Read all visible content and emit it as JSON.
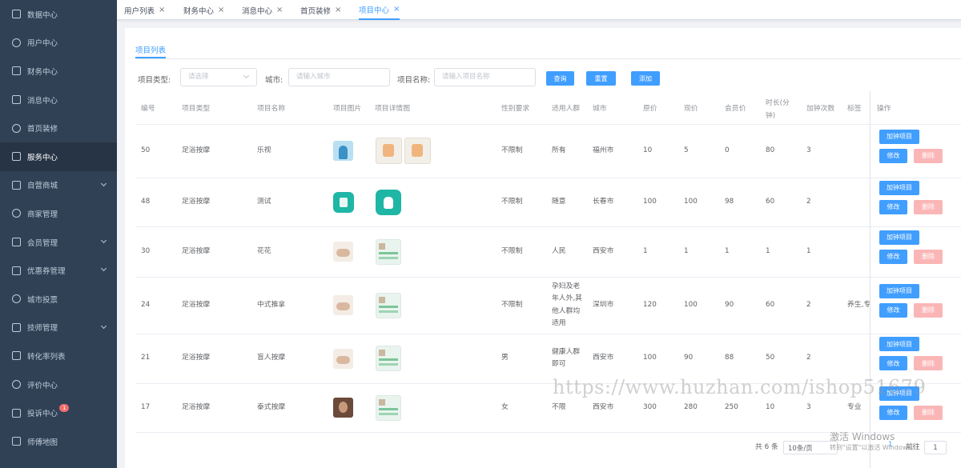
{
  "sidebar": {
    "items": [
      {
        "label": "数据中心",
        "icon": "chart-icon",
        "chevron": false
      },
      {
        "label": "用户中心",
        "icon": "user-icon",
        "chevron": false
      },
      {
        "label": "财务中心",
        "icon": "wallet-icon",
        "chevron": false
      },
      {
        "label": "消息中心",
        "icon": "message-icon",
        "chevron": false
      },
      {
        "label": "首页装修",
        "icon": "cube-icon",
        "chevron": false
      },
      {
        "label": "服务中心",
        "icon": "clipboard-icon",
        "chevron": false,
        "active": true
      },
      {
        "label": "自营商城",
        "icon": "home-icon",
        "chevron": true
      },
      {
        "label": "商家管理",
        "icon": "user-icon",
        "chevron": false
      },
      {
        "label": "会员管理",
        "icon": "member-icon",
        "chevron": true
      },
      {
        "label": "优惠券管理",
        "icon": "coupon-icon",
        "chevron": true
      },
      {
        "label": "城市投票",
        "icon": "vote-icon",
        "chevron": false
      },
      {
        "label": "技师管理",
        "icon": "technician-icon",
        "chevron": true
      },
      {
        "label": "转化率列表",
        "icon": "refresh-icon",
        "chevron": false
      },
      {
        "label": "评价中心",
        "icon": "comment-icon",
        "chevron": false
      },
      {
        "label": "投诉中心",
        "icon": "complaint-icon",
        "chevron": false,
        "badge": "1"
      },
      {
        "label": "师傅地图",
        "icon": "location-icon",
        "chevron": false
      }
    ]
  },
  "tabs": [
    {
      "label": "用户列表",
      "close": "×"
    },
    {
      "label": "财务中心",
      "close": "×"
    },
    {
      "label": "消息中心",
      "close": "×"
    },
    {
      "label": "首页装修",
      "close": "×"
    },
    {
      "label": "项目中心",
      "close": "×",
      "active": true
    }
  ],
  "subtab": {
    "label": "项目列表"
  },
  "filters": {
    "type_label": "项目类型:",
    "type_placeholder": "请选择",
    "city_label": "城市:",
    "city_placeholder": "请输入城市",
    "name_label": "项目名称:",
    "name_placeholder": "请输入项目名称",
    "search_btn": "查询",
    "reset_btn": "重置",
    "add_btn": "添加"
  },
  "table": {
    "headers": {
      "id": "编号",
      "type": "项目类型",
      "name": "项目名称",
      "image": "项目图片",
      "detail": "项目详情图",
      "gender": "性别要求",
      "crowd": "适用人群",
      "city": "城市",
      "orig_price": "原价",
      "price": "现价",
      "member_price": "会员价",
      "duration_1": "时长(分",
      "duration_2": "钟)",
      "extra": "加钟次数",
      "tags": "标签",
      "ops": "操作"
    },
    "rows": [
      {
        "id": "50",
        "type": "足浴按摩",
        "name": "乐视",
        "gender": "不限制",
        "crowd": [
          "所有"
        ],
        "city": "福州市",
        "orig_price": "10",
        "price": "5",
        "member_price": "0",
        "duration": "80",
        "extra": "3",
        "tags": "",
        "img": "t-avatar",
        "details": [
          "t-ill",
          "t-ill"
        ]
      },
      {
        "id": "48",
        "type": "足浴按摩",
        "name": "测试",
        "gender": "不限制",
        "crowd": [
          "随意"
        ],
        "city": "长春市",
        "orig_price": "100",
        "price": "100",
        "member_price": "98",
        "duration": "60",
        "extra": "2",
        "tags": "",
        "img": "t-teal",
        "details": [
          "t-teal2"
        ]
      },
      {
        "id": "30",
        "type": "足浴按摩",
        "name": "花花",
        "gender": "不限制",
        "crowd": [
          "人民"
        ],
        "city": "西安市",
        "orig_price": "1",
        "price": "1",
        "member_price": "1",
        "duration": "1",
        "extra": "1",
        "tags": "",
        "img": "t-massage",
        "details": [
          "t-detail"
        ]
      },
      {
        "id": "24",
        "type": "足浴按摩",
        "name": "中式推拿",
        "gender": "不限制",
        "crowd": [
          "孕妇及老",
          "年人外,其",
          "他人群均",
          "适用"
        ],
        "city": "深圳市",
        "orig_price": "120",
        "price": "100",
        "member_price": "90",
        "duration": "60",
        "extra": "2",
        "tags": "养生,专",
        "img": "t-massage",
        "details": [
          "t-detail"
        ]
      },
      {
        "id": "21",
        "type": "足浴按摩",
        "name": "盲人按摩",
        "gender": "男",
        "crowd": [
          "健康人群",
          "即可"
        ],
        "city": "西安市",
        "orig_price": "100",
        "price": "90",
        "member_price": "88",
        "duration": "50",
        "extra": "2",
        "tags": "",
        "img": "t-massage",
        "details": [
          "t-detail"
        ]
      },
      {
        "id": "17",
        "type": "足浴按摩",
        "name": "泰式按摩",
        "gender": "女",
        "crowd": [
          "不限"
        ],
        "city": "西安市",
        "orig_price": "300",
        "price": "280",
        "member_price": "250",
        "duration": "10",
        "extra": "3",
        "tags": "专业",
        "img": "t-dark",
        "details": [
          "t-detail"
        ]
      }
    ],
    "ops": {
      "extra_btn": "加钟项目",
      "edit_btn": "修改",
      "delete_btn": "删除"
    }
  },
  "pagination": {
    "total": "共 6 条",
    "page_size": "10条/页",
    "current": "1",
    "goto_label": "前往",
    "goto_value": "1"
  },
  "overlays": {
    "watermark": "https://www.huzhan.com/ishop51679",
    "activate_title": "激活 Windows",
    "activate_hint": "转到\"设置\"以激活 Windows。"
  },
  "colors": {
    "primary": "#409eff",
    "sidebar": "#304156",
    "danger_light": "#fab6b6",
    "badge": "#f56c6c"
  }
}
